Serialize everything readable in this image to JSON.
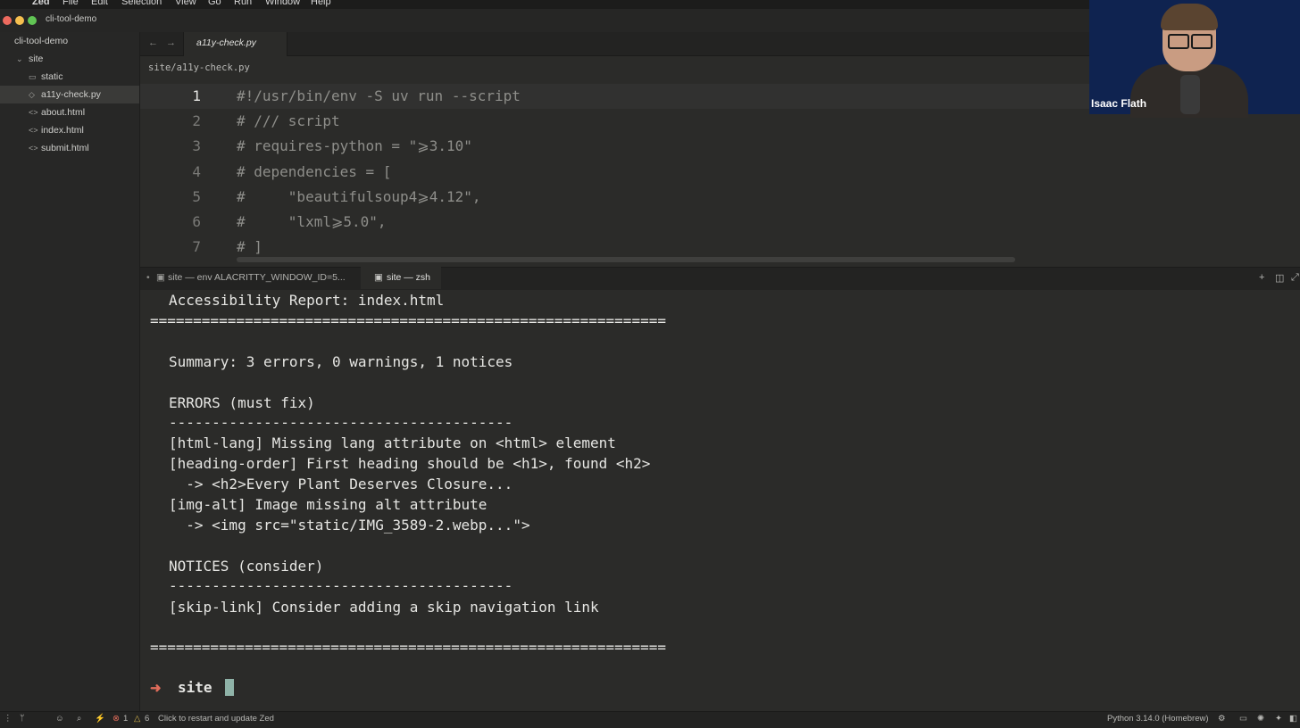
{
  "menubar": {
    "items": [
      "Zed",
      "File",
      "Edit",
      "Selection",
      "View",
      "Go",
      "Run",
      "Window",
      "Help"
    ]
  },
  "window": {
    "project": "cli-tool-demo",
    "traffic_colors": [
      "#ed6a5e",
      "#f5bf4f",
      "#61c554"
    ]
  },
  "sidebar": {
    "root": "cli-tool-demo",
    "items": [
      {
        "label": "site",
        "icon": "chevron-down-icon"
      },
      {
        "label": "static",
        "icon": "folder-icon"
      },
      {
        "label": "a11y-check.py",
        "icon": "file-icon",
        "selected": true
      },
      {
        "label": "about.html",
        "icon": "code-file-icon"
      },
      {
        "label": "index.html",
        "icon": "code-file-icon"
      },
      {
        "label": "submit.html",
        "icon": "code-file-icon"
      }
    ]
  },
  "editor": {
    "tab_label": "a11y-check.py",
    "breadcrumb": "site/a11y-check.py",
    "lines": [
      {
        "num": "1",
        "text": "#!/usr/bin/env -S uv run --script"
      },
      {
        "num": "2",
        "text": "# /// script"
      },
      {
        "num": "3",
        "text": "# requires-python = \"⩾3.10\""
      },
      {
        "num": "4",
        "text": "# dependencies = ["
      },
      {
        "num": "5",
        "text": "#     \"beautifulsoup4⩾4.12\","
      },
      {
        "num": "6",
        "text": "#     \"lxml⩾5.0\","
      },
      {
        "num": "7",
        "text": "# ]"
      }
    ]
  },
  "terminal": {
    "tabs": [
      "site — env ALACRITTY_WINDOW_ID=5...",
      "site — zsh"
    ],
    "lines": [
      "Accessibility Report: index.html",
      "============================================================",
      "Summary: 3 errors, 0 warnings, 1 notices",
      "ERRORS (must fix)",
      "----------------------------------------",
      "[html-lang] Missing lang attribute on <html> element",
      "[heading-order] First heading should be <h1>, found <h2>",
      "  -> <h2>Every Plant Deserves Closure...",
      "[img-alt] Image missing alt attribute",
      "  -> <img src=\"static/IMG_3589-2.webp...\">",
      "NOTICES (consider)",
      "----------------------------------------",
      "[skip-link] Consider adding a skip navigation link",
      "============================================================"
    ],
    "prompt_symbol": "➜",
    "prompt_dir": "site"
  },
  "video": {
    "name": "Isaac Flath"
  },
  "statusbar": {
    "errors": "1",
    "warnings": "6",
    "message": "Click to restart and update Zed",
    "language": "Python 3.14.0 (Homebrew)"
  }
}
